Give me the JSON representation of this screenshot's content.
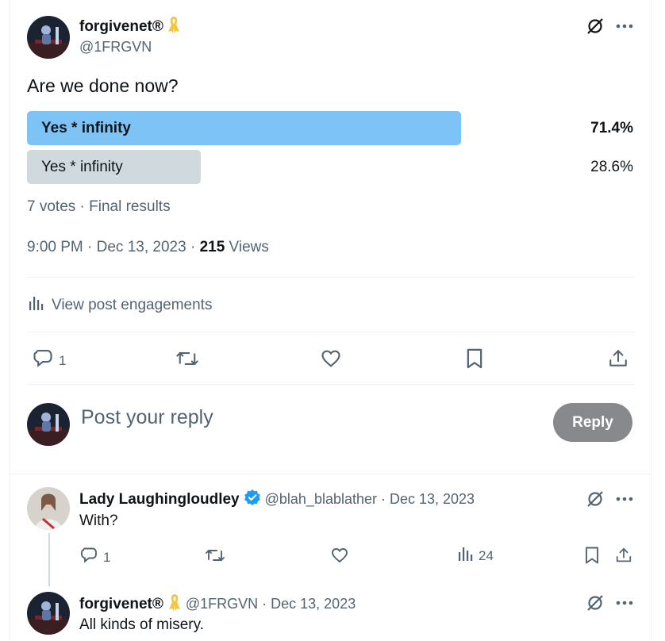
{
  "main_post": {
    "author_name": "forgivenet®",
    "author_badge_emoji": "🎗",
    "handle": "@1FRGVN",
    "text": "Are we done now?",
    "poll": {
      "options": [
        {
          "label": "Yes * infinity",
          "percent_text": "71.4%",
          "percent": 71.4,
          "winner": true
        },
        {
          "label": "Yes * infinity",
          "percent_text": "28.6%",
          "percent": 28.6,
          "winner": false
        }
      ],
      "summary": "7 votes · Final results"
    },
    "timestamp": "9:00 PM · Dec 13, 2023 · ",
    "views_count": "215",
    "views_label": " Views",
    "engagements_label": "View post engagements",
    "reply_count": "1"
  },
  "composer": {
    "placeholder": "Post your reply",
    "reply_button": "Reply"
  },
  "replies": [
    {
      "author_name": "Lady Laughingloudley",
      "verified": true,
      "meta": "@blah_blablather · Dec 13, 2023",
      "text": "With?",
      "reply_count": "1",
      "views_count": "24"
    },
    {
      "author_name": "forgivenet®",
      "author_badge_emoji": "🎗",
      "meta": "@1FRGVN · Dec 13, 2023",
      "text": "All kinds of misery."
    }
  ],
  "colors": {
    "poll_winner": "#7ec3f5",
    "poll_other": "#cfd9de",
    "verified": "#1d9bf0",
    "ribbon": "#f5c542",
    "reply_button": "#87898c"
  }
}
